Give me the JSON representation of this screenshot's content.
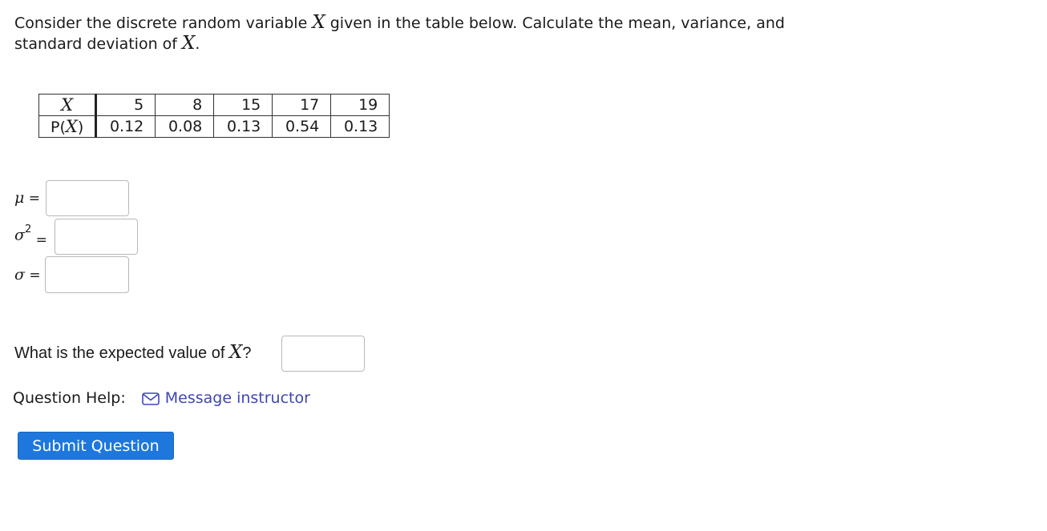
{
  "question": {
    "text_before": "Consider the discrete random variable ",
    "var1": "X",
    "text_middle": " given in the table below. Calculate the mean, variance, and standard deviation of ",
    "var2": "X",
    "text_end": "."
  },
  "table": {
    "row1_label": "X",
    "row2_label_prefix": "P(",
    "row2_label_var": "X",
    "row2_label_suffix": ")",
    "x_values": [
      "5",
      "8",
      "15",
      "17",
      "19"
    ],
    "p_values": [
      "0.12",
      "0.08",
      "0.13",
      "0.54",
      "0.13"
    ]
  },
  "answers": {
    "mean_symbol": "μ",
    "mean_eq": "=",
    "mean_value": "",
    "variance_symbol": "σ",
    "variance_exponent": "2",
    "variance_eq": "=",
    "variance_value": "",
    "sd_symbol": "σ",
    "sd_eq": "=",
    "sd_value": ""
  },
  "expected": {
    "text": "What is the expected value of ",
    "var": "X",
    "suffix": "?",
    "value": ""
  },
  "help": {
    "label": "Question Help:",
    "icon": "mail-icon",
    "link_text": "Message instructor"
  },
  "submit_label": "Submit Question",
  "colors": {
    "link": "#3f45b8",
    "button": "#1e77dc"
  }
}
